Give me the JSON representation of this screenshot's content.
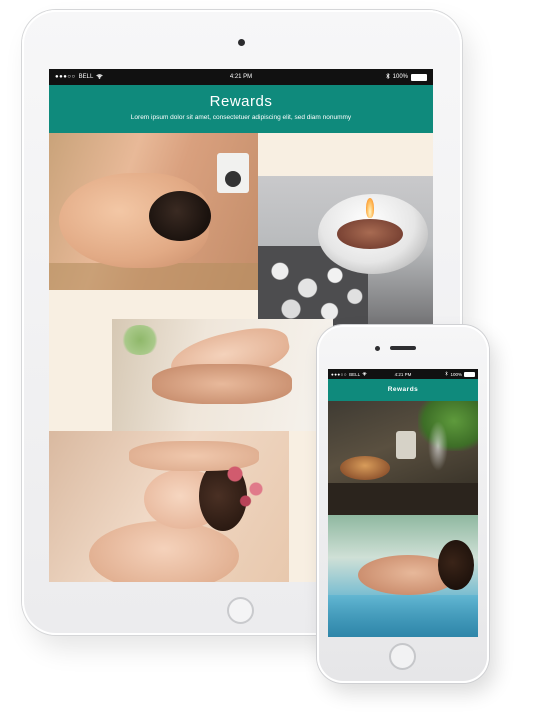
{
  "colors": {
    "header_teal": "#0f8a7c",
    "statusbar_black": "#111111",
    "device_body": "#f2f2f3",
    "screen_cream": "#f8efe2"
  },
  "tablet": {
    "status": {
      "carrier_dots": "●●●○○",
      "carrier": "BELL",
      "wifi_icon": "wifi-icon",
      "time": "4:21 PM",
      "bluetooth_icon": "bluetooth-icon",
      "battery": "100%"
    },
    "header": {
      "title": "Rewards",
      "subtitle": "Lorem ipsum dolor sit amet, consectetuer adipiscing elit, sed diam nonummy"
    },
    "photos": [
      "back-massage-photo",
      "spa-candle-photo",
      "foot-massage-photo",
      "facial-massage-photo"
    ]
  },
  "phone": {
    "status": {
      "carrier_dots": "●●●○○",
      "carrier": "BELL",
      "wifi_icon": "wifi-icon",
      "time": "4:21 PM",
      "bluetooth_icon": "bluetooth-icon",
      "battery": "100%"
    },
    "header": {
      "title": "Rewards"
    },
    "photos": [
      "incense-photo",
      "pool-relax-photo"
    ]
  }
}
